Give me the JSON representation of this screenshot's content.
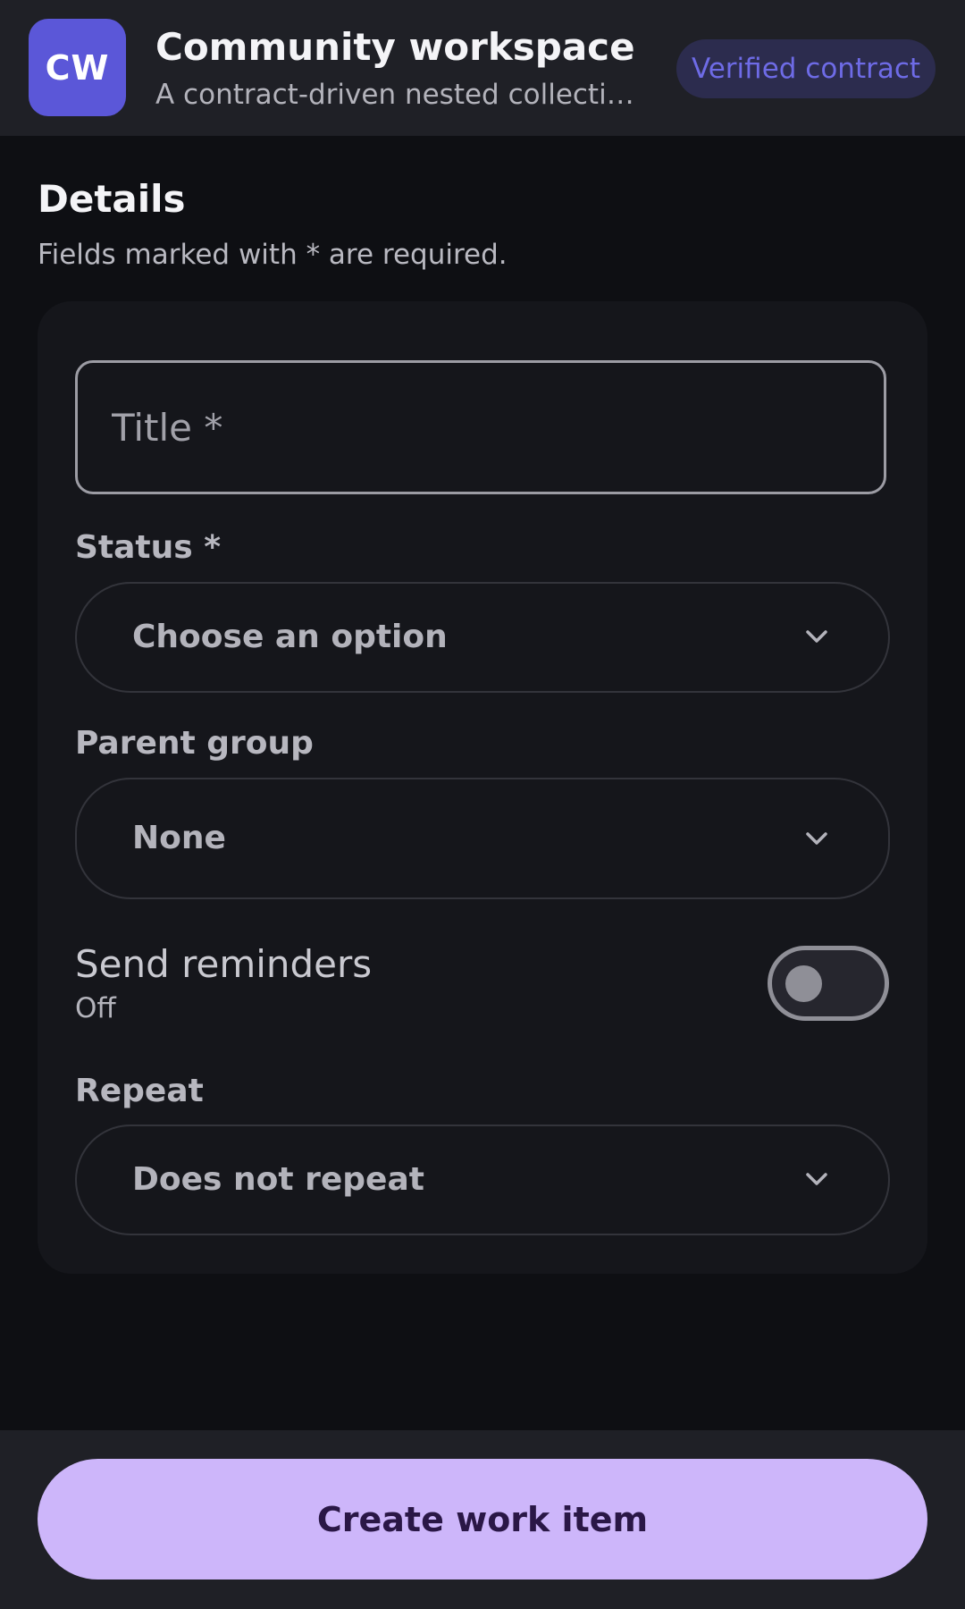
{
  "header": {
    "avatar_initials": "CW",
    "title": "Community workspace",
    "subtitle": "A contract-driven nested collection …",
    "badge": "Verified contract"
  },
  "section": {
    "title": "Details",
    "subtitle": "Fields marked with * are required."
  },
  "form": {
    "title_field": {
      "placeholder": "Title *",
      "value": ""
    },
    "status": {
      "label": "Status *",
      "value": "Choose an option",
      "icon": "chevron-down-icon"
    },
    "parent_group": {
      "label": "Parent group",
      "value": "None",
      "icon": "chevron-down-icon"
    },
    "reminders": {
      "label": "Send reminders",
      "state": "Off",
      "on": false
    },
    "repeat": {
      "label": "Repeat",
      "value": "Does not repeat",
      "icon": "chevron-down-icon"
    }
  },
  "footer": {
    "submit_label": "Create work item"
  },
  "colors": {
    "accent": "#5b57d8",
    "badge_text": "#6e6be6",
    "cta_bg": "#cdb6fa",
    "cta_text": "#2a1746",
    "background": "#0e0f13",
    "card": "#15161b"
  }
}
